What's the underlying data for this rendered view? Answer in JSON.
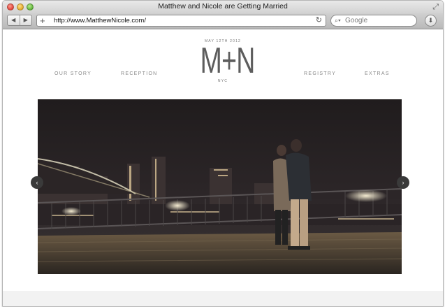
{
  "window": {
    "title": "Matthew and Nicole are Getting Married"
  },
  "toolbar": {
    "back_icon": "back-arrow-icon",
    "forward_icon": "forward-arrow-icon",
    "new_tab": "+",
    "url": "http://www.MatthewNicole.com/",
    "search_placeholder": "Google"
  },
  "site": {
    "nav_left": [
      "OUR STORY",
      "RECEPTION"
    ],
    "nav_right": [
      "REGISTRY",
      "EXTRAS"
    ],
    "monogram": {
      "date": "MAY 12TH 2012",
      "letters": "M+N",
      "city": "NYC"
    }
  },
  "colors": {
    "nav_text": "#8a8a8a",
    "monogram": "#5d5d5d",
    "slideshow_bg": "#1e1b1c"
  }
}
